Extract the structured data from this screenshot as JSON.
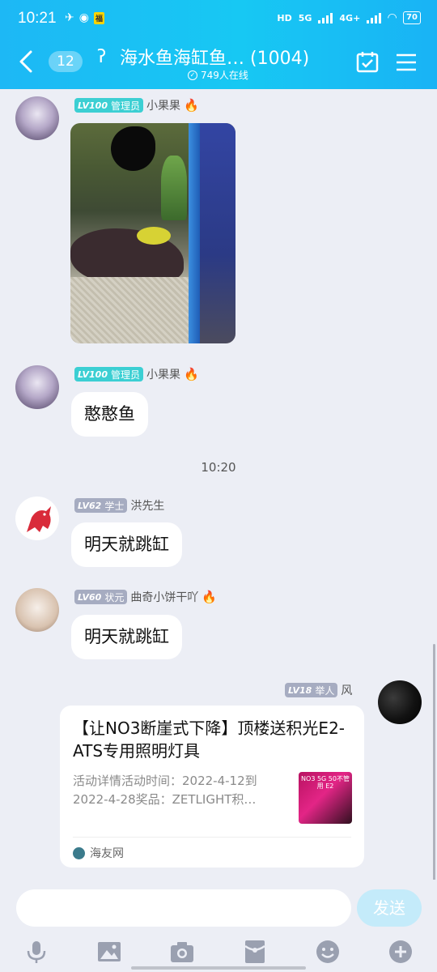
{
  "status_bar": {
    "time": "10:21",
    "network_labels": [
      "HD",
      "5G",
      "4G+"
    ],
    "battery": "70"
  },
  "header": {
    "unread_count": "12",
    "title": "海水鱼海缸鱼… (1004)",
    "online": "749人在线"
  },
  "messages": [
    {
      "level": "LV100",
      "role": "管理员",
      "name": "小果果",
      "type": "image"
    },
    {
      "level": "LV100",
      "role": "管理员",
      "name": "小果果",
      "text": "憨憨鱼"
    },
    {
      "time_separator": "10:20"
    },
    {
      "level": "LV62",
      "role": "学士",
      "name": "洪先生",
      "text": "明天就跳缸"
    },
    {
      "level": "LV60",
      "role": "状元",
      "name": "曲奇小饼干吖",
      "text": "明天就跳缸"
    },
    {
      "level": "LV18",
      "role": "举人",
      "name": "风",
      "card": {
        "title": "【让NO3断崖式下降】顶楼送积光E2-ATS专用照明灯具",
        "description": "活动详情活动时间：2022-4-12到2022-4-28奖品：ZETLIGHT积…",
        "thumb_text": "NO3 5G 50不管用 E2",
        "source": "海友网"
      }
    }
  ],
  "input": {
    "placeholder": "",
    "send_label": "发送"
  },
  "toolbar_icons": [
    "microphone-icon",
    "image-icon",
    "camera-icon",
    "red-packet-icon",
    "emoji-icon",
    "plus-icon"
  ]
}
